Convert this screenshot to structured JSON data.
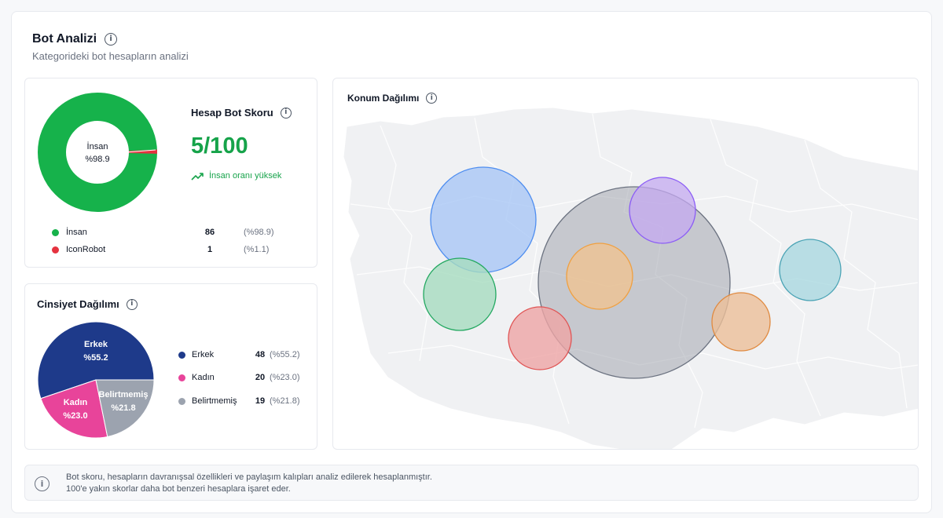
{
  "header": {
    "title": "Bot Analizi",
    "subtitle": "Kategorideki bot hesapların analizi"
  },
  "bot_card": {
    "donut_center_label": "İnsan",
    "donut_center_value": "%98.9",
    "score_title": "Hesap Bot Skoru",
    "score_value": "5/100",
    "trend_text": "İnsan oranı yüksek",
    "legend": [
      {
        "label": "İnsan",
        "count": "86",
        "percent": "(%98.9)",
        "color": "#16b24b"
      },
      {
        "label": "IconRobot",
        "count": "1",
        "percent": "(%1.1)",
        "color": "#e5323f"
      }
    ]
  },
  "gender_card": {
    "title": "Cinsiyet Dağılımı",
    "slices": [
      {
        "label": "Erkek",
        "count": "48",
        "percent": "(%55.2)",
        "inline_percent": "%55.2",
        "value": 55.2,
        "color": "#1e3a8a"
      },
      {
        "label": "Kadın",
        "count": "20",
        "percent": "(%23.0)",
        "inline_percent": "%23.0",
        "value": 23.0,
        "color": "#e8449a"
      },
      {
        "label": "Belirtmemiş",
        "count": "19",
        "percent": "(%21.8)",
        "inline_percent": "%21.8",
        "value": 21.8,
        "color": "#9ca3af"
      }
    ]
  },
  "map_card": {
    "title": "Konum Dağılımı",
    "bubbles": [
      {
        "color": "#4f8ef0"
      },
      {
        "color": "#6b7280"
      },
      {
        "color": "#8b5cf6"
      },
      {
        "color": "#f0a040"
      },
      {
        "color": "#22a860"
      },
      {
        "color": "#e05555"
      },
      {
        "color": "#e08a40"
      },
      {
        "color": "#4aa3b5"
      }
    ]
  },
  "note": {
    "line1": "Bot skoru, hesapların davranışsal özellikleri ve paylaşım kalıpları analiz edilerek hesaplanmıştır.",
    "line2": "100'e yakın skorlar daha bot benzeri hesaplara işaret eder."
  },
  "colors": {
    "accent_green": "#16a34a",
    "donut_human": "#16b24b",
    "donut_bot": "#e5323f"
  }
}
